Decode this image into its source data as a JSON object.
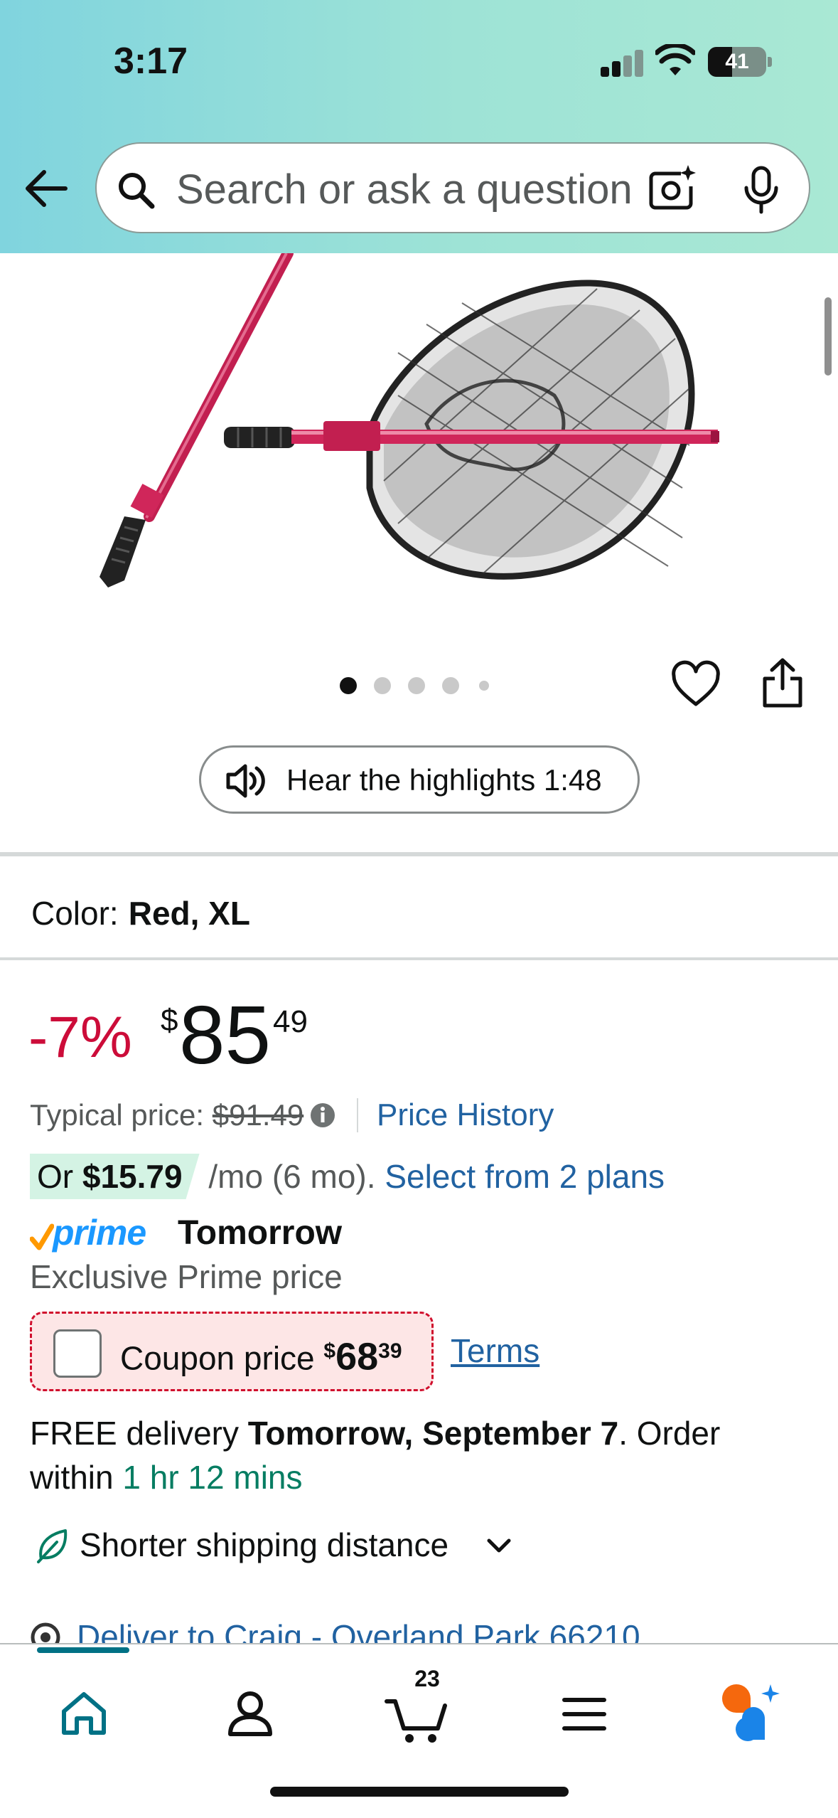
{
  "status_bar": {
    "time": "3:17",
    "battery": "41",
    "battery_level": 0.41
  },
  "search": {
    "placeholder": "Search or ask a question"
  },
  "gallery": {
    "image_count": 5,
    "active_index": 0
  },
  "audio": {
    "label": "Hear the highlights 1:48"
  },
  "variation": {
    "label": "Color:",
    "value": "Red, XL"
  },
  "price": {
    "discount": "-7%",
    "currency": "$",
    "whole": "85",
    "fraction": "49",
    "typical_label": "Typical price:",
    "typical_value": "$91.49",
    "history_link": "Price History"
  },
  "installments": {
    "prefix": "Or",
    "amount": "$15.79",
    "term": "/mo (6 mo).",
    "link": "Select from 2 plans"
  },
  "prime": {
    "word": "prime",
    "speed": "Tomorrow",
    "exclusive": "Exclusive Prime price"
  },
  "coupon": {
    "label": "Coupon price",
    "currency": "$",
    "whole": "68",
    "fraction": "39",
    "checked": false,
    "terms": "Terms"
  },
  "delivery": {
    "prefix": "FREE delivery",
    "date": "Tomorrow, September 7",
    "middle": ". Order within",
    "countdown": "1 hr 12 mins"
  },
  "shipping": {
    "label": "Shorter shipping distance"
  },
  "deliver_to": {
    "label": "Deliver to Craig - Overland Park 66210"
  },
  "bottom_nav": {
    "items": [
      "home",
      "account",
      "cart",
      "menu",
      "rufus"
    ],
    "active": "home",
    "cart_count": "23"
  },
  "colors": {
    "header_start": "#80d4de",
    "header_end": "#a9e8d4",
    "discount": "#cc0c39",
    "link": "#2162a1",
    "green": "#067d62",
    "prime_blue": "#1a98ff",
    "coupon_bg": "#fde6e6",
    "coupon_border": "#d00f2d",
    "product_handle": "#d0265a"
  }
}
